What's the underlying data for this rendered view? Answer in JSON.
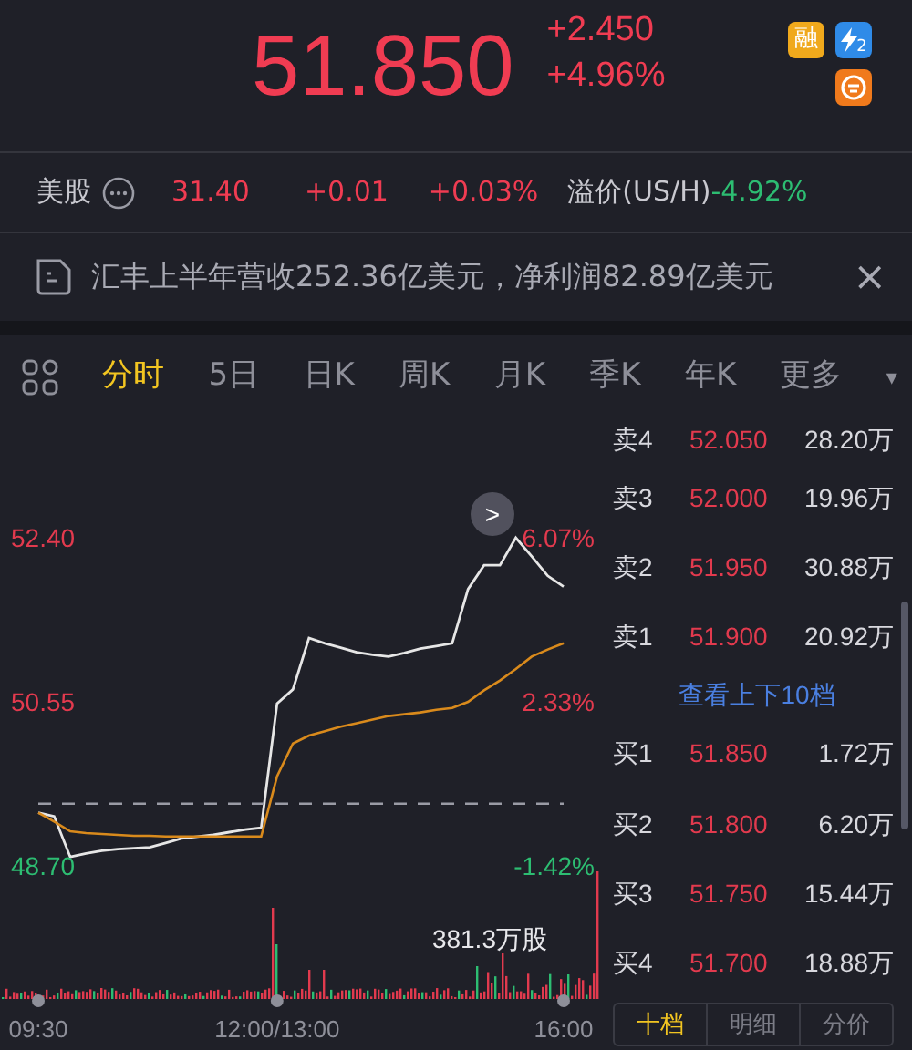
{
  "quote": {
    "price": "51.850",
    "change": "+2.450",
    "change_pct": "+4.96%",
    "badges": [
      {
        "kind": "margin",
        "text": "融"
      },
      {
        "kind": "flash",
        "text": "2"
      },
      {
        "kind": "short"
      }
    ]
  },
  "us_row": {
    "label": "美股",
    "price": "31.40",
    "change": "+0.01",
    "change_pct": "+0.03%",
    "premium_label": "溢价(US/H)",
    "premium": "-4.92%"
  },
  "news": {
    "text": "汇丰上半年营收252.36亿美元，净利润82.89亿美元",
    "close": "×"
  },
  "tabs": [
    {
      "label": "分时",
      "selected": true
    },
    {
      "label": "5日",
      "selected": false
    },
    {
      "label": "日K",
      "selected": false
    },
    {
      "label": "周K",
      "selected": false
    },
    {
      "label": "月K",
      "selected": false
    },
    {
      "label": "季K",
      "selected": false
    },
    {
      "label": "年K",
      "selected": false
    },
    {
      "label": "更多",
      "selected": false
    }
  ],
  "more_caret": "▾",
  "chart": {
    "chart_data": {
      "type": "line",
      "categories": [
        "09:30",
        null,
        null,
        null,
        null,
        null,
        null,
        null,
        null,
        null,
        null,
        null,
        null,
        null,
        null,
        "12:00/13:00",
        null,
        null,
        null,
        null,
        null,
        null,
        null,
        null,
        null,
        null,
        null,
        null,
        null,
        null,
        null,
        null,
        null,
        "16:00"
      ],
      "series": [
        {
          "color": "#e6e6e6",
          "values": [
            49.3,
            49.26,
            48.8,
            48.84,
            48.87,
            48.89,
            48.9,
            48.91,
            48.96,
            49.01,
            49.03,
            49.05,
            49.08,
            49.11,
            49.13,
            50.53,
            50.69,
            51.27,
            51.21,
            51.16,
            51.11,
            51.08,
            51.06,
            51.1,
            51.15,
            51.18,
            51.21,
            51.82,
            52.09,
            52.09,
            52.4,
            52.19,
            51.97,
            51.85
          ]
        },
        {
          "color": "#d98a1c",
          "values": [
            49.3,
            49.2,
            49.09,
            49.07,
            49.06,
            49.05,
            49.04,
            49.04,
            49.03,
            49.03,
            49.03,
            49.03,
            49.03,
            49.03,
            49.03,
            49.71,
            50.08,
            50.17,
            50.22,
            50.27,
            50.31,
            50.35,
            50.39,
            50.41,
            50.43,
            50.46,
            50.48,
            50.55,
            50.68,
            50.79,
            50.92,
            51.06,
            51.14,
            51.21
          ]
        },
        {
          "color": "#9a9ba5",
          "line_style": "dashed",
          "values": [
            49.4,
            49.4,
            49.4,
            49.4,
            49.4,
            49.4,
            49.4,
            49.4,
            49.4,
            49.4,
            49.4,
            49.4,
            49.4,
            49.4,
            49.4,
            49.4,
            49.4,
            49.4,
            49.4,
            49.4,
            49.4,
            49.4,
            49.4,
            49.4,
            49.4,
            49.4,
            49.4,
            49.4,
            49.4,
            49.4,
            49.4,
            49.4,
            49.4,
            49.4
          ]
        }
      ],
      "ylim": [
        48.7,
        52.4
      ],
      "yticks": [
        {
          "value": 52.4,
          "label": "52.40"
        },
        {
          "value": 50.55,
          "label": "50.55"
        },
        {
          "value": 48.7,
          "label": "48.70"
        }
      ]
    },
    "percent_ticks": [
      "6.07%",
      "2.33%",
      "-1.42%"
    ],
    "expand_button": ">",
    "volume_label": "381.3万股"
  },
  "order_book": {
    "asks": [
      {
        "label": "卖4",
        "price": "52.050",
        "volume": "28.20万"
      },
      {
        "label": "卖3",
        "price": "52.000",
        "volume": "19.96万"
      },
      {
        "label": "卖2",
        "price": "51.950",
        "volume": "30.88万"
      },
      {
        "label": "卖1",
        "price": "51.900",
        "volume": "20.92万"
      }
    ],
    "link": "查看上下10档",
    "bids": [
      {
        "label": "买1",
        "price": "51.850",
        "volume": "1.72万"
      },
      {
        "label": "买2",
        "price": "51.800",
        "volume": "6.20万"
      },
      {
        "label": "买3",
        "price": "51.750",
        "volume": "15.44万"
      },
      {
        "label": "买4",
        "price": "51.700",
        "volume": "18.88万"
      }
    ],
    "tabs": [
      {
        "label": "十档",
        "selected": true
      },
      {
        "label": "明细",
        "selected": false
      },
      {
        "label": "分价",
        "selected": false
      }
    ]
  }
}
